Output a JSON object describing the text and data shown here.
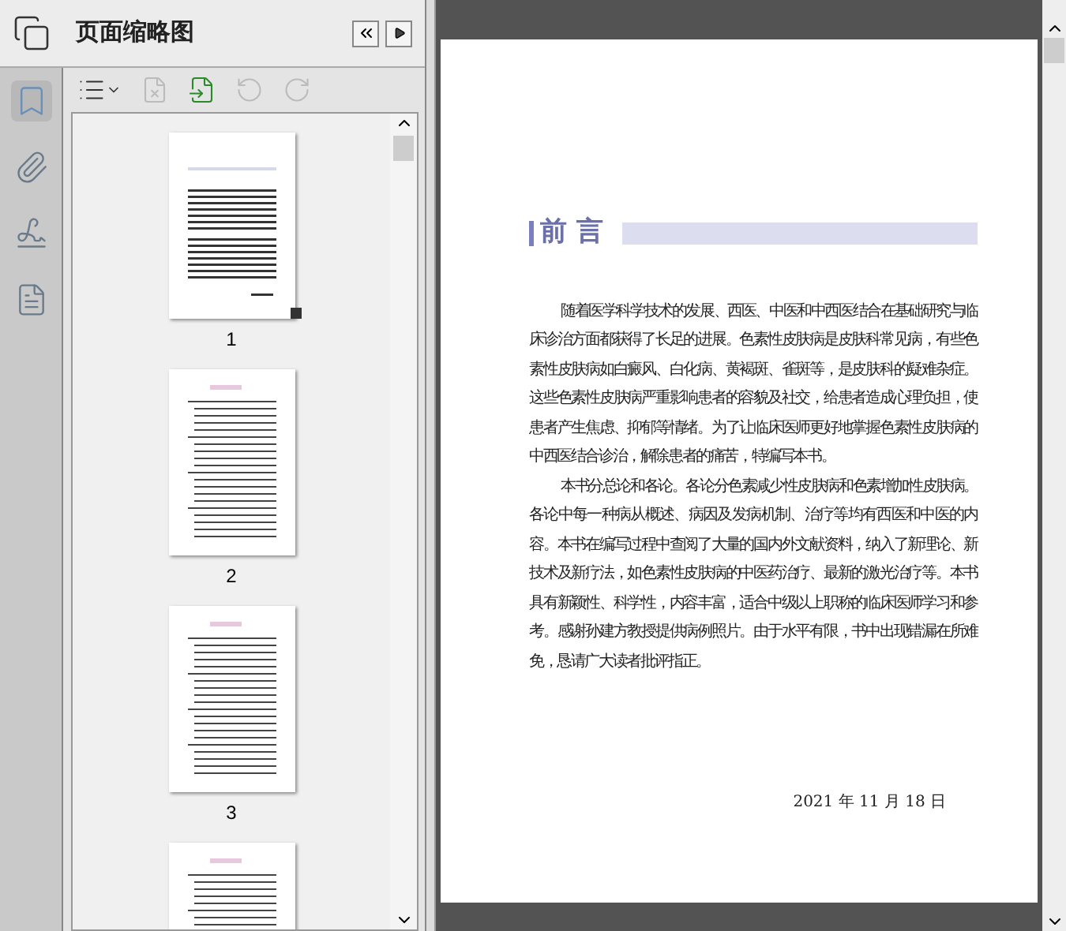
{
  "panel": {
    "title": "页面缩略图"
  },
  "toolbar": [
    {
      "kind": "options",
      "disabled": false
    },
    {
      "kind": "delete",
      "disabled": true
    },
    {
      "kind": "insert",
      "disabled": false
    },
    {
      "kind": "rotate_left",
      "disabled": true
    },
    {
      "kind": "rotate_right",
      "disabled": true
    }
  ],
  "sidebar": [
    {
      "kind": "bookmarks",
      "selected": true
    },
    {
      "kind": "attachments",
      "selected": false
    },
    {
      "kind": "signatures",
      "selected": false
    },
    {
      "kind": "document",
      "selected": false
    }
  ],
  "thumbnails": [
    {
      "label": "1",
      "selected": true,
      "kind": "preface"
    },
    {
      "label": "2",
      "selected": false,
      "kind": "contents"
    },
    {
      "label": "3",
      "selected": false,
      "kind": "contents"
    },
    {
      "kind": "contents"
    }
  ],
  "document": {
    "heading": "前 言",
    "paragraphs": [
      "随着医学科学技术的发展、西医、中医和中西医结合在基础研究与临床诊治方面都获得了长足的进展。色素性皮肤病是皮肤科常见病，有些色素性皮肤病如白癜风、白化病、黄褐斑、雀斑等，是皮肤科的疑难杂症。这些色素性皮肤病严重影响患者的容貌及社交，给患者造成心理负担，使患者产生焦虑、抑郁等情绪。为了让临床医师更好地掌握色素性皮肤病的中西医结合诊治，解除患者的痛苦，特编写本书。",
      "本书分总论和各论。各论分色素减少性皮肤病和色素增加性皮肤病。各论中每一种病从概述、病因及发病机制、治疗等均有西医和中医的内容。本书在编写过程中查阅了大量的国内外文献资料，纳入了新理论、新技术及新疗法，如色素性皮肤病的中医药治疗、最新的激光治疗等。本书具有新颖性、科学性，内容丰富，适合中级以上职称的临床医师学习和参考。感谢孙建方教授提供病例照片。由于水平有限，书中出现错漏在所难免，恳请广大读者批评指正。"
    ],
    "date": "2021 年 11 月 18 日"
  }
}
